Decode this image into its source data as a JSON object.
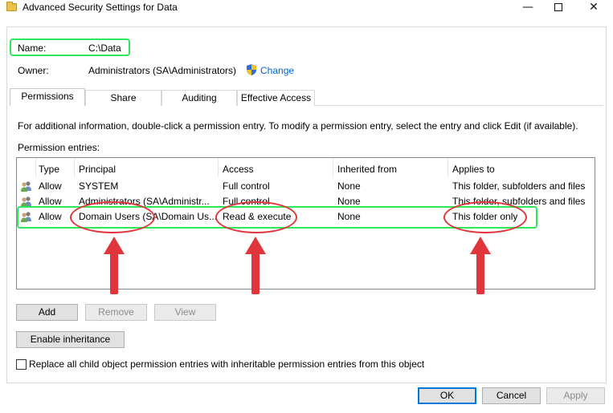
{
  "window": {
    "title": "Advanced Security Settings for Data",
    "minimize_glyph": "—",
    "close_glyph": "✕"
  },
  "object": {
    "name_label": "Name:",
    "name_value": "C:\\Data",
    "owner_label": "Owner:",
    "owner_value": "Administrators (SA\\Administrators)",
    "change_link": "Change"
  },
  "tabs": [
    {
      "label": "Permissions",
      "active": true
    },
    {
      "label": "Share",
      "active": false
    },
    {
      "label": "Auditing",
      "active": false
    },
    {
      "label": "Effective Access",
      "active": false
    }
  ],
  "info_text": "For additional information, double-click a permission entry. To modify a permission entry, select the entry and click Edit (if available).",
  "entries_label": "Permission entries:",
  "columns": [
    "Type",
    "Principal",
    "Access",
    "Inherited from",
    "Applies to"
  ],
  "rows": [
    {
      "type": "Allow",
      "principal": "SYSTEM",
      "access": "Full control",
      "inherited": "None",
      "applies": "This folder, subfolders and files"
    },
    {
      "type": "Allow",
      "principal": "Administrators (SA\\Administr...",
      "access": "Full control",
      "inherited": "None",
      "applies": "This folder, subfolders and files"
    },
    {
      "type": "Allow",
      "principal": "Domain Users (SA\\Domain Us...",
      "access": "Read & execute",
      "inherited": "None",
      "applies": "This folder only"
    }
  ],
  "buttons": {
    "add": "Add",
    "remove": "Remove",
    "view": "View",
    "enable_inheritance": "Enable inheritance",
    "ok": "OK",
    "cancel": "Cancel",
    "apply": "Apply"
  },
  "replace_checkbox": {
    "label": "Replace all child object permission entries with inheritable permission entries from this object",
    "checked": false
  },
  "colors": {
    "highlight_green": "#2ee85a",
    "annotation_red": "#e0353a",
    "link_blue": "#0066cc",
    "default_button_border": "#0078d7"
  },
  "icons": [
    "folder-icon",
    "shield-icon",
    "users-icon"
  ]
}
